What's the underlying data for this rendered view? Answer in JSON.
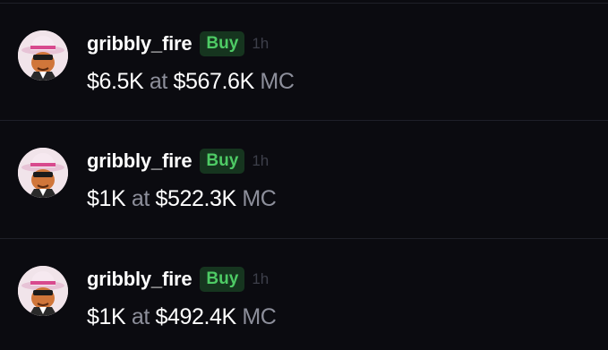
{
  "trades": [
    {
      "username": "gribbly_fire",
      "side": "Buy",
      "time": "1h",
      "amount": "$6.5K",
      "at_word": "at",
      "market_cap": "$567.6K",
      "mc_suffix": "MC"
    },
    {
      "username": "gribbly_fire",
      "side": "Buy",
      "time": "1h",
      "amount": "$1K",
      "at_word": "at",
      "market_cap": "$522.3K",
      "mc_suffix": "MC"
    },
    {
      "username": "gribbly_fire",
      "side": "Buy",
      "time": "1h",
      "amount": "$1K",
      "at_word": "at",
      "market_cap": "$492.4K",
      "mc_suffix": "MC"
    }
  ],
  "colors": {
    "background": "#0b0b10",
    "buy_badge_bg": "#16351f",
    "buy_badge_text": "#4ecb65",
    "muted_text": "#8d8f9b"
  }
}
